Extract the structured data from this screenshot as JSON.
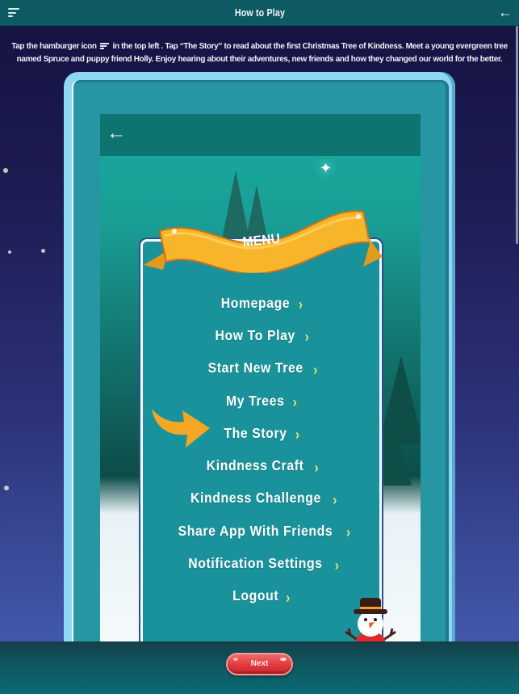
{
  "header": {
    "title": "How to Play",
    "menu_icon": "hamburger-icon",
    "back_icon": "arrow-left-icon"
  },
  "instructions": {
    "part1": "Tap the hamburger icon",
    "part2": "in the top left . Tap “The Story” to read about the first Christmas Tree of Kindness. Meet a young evergreen tree named Spruce and puppy friend Holly. Enjoy hearing about their adventures, new friends and how they changed our world for the better."
  },
  "preview": {
    "back_icon": "arrow-left-icon",
    "ribbon_label": "MENU",
    "highlighted_item": "The Story",
    "menu_items": [
      {
        "label": "Homepage"
      },
      {
        "label": "How To Play"
      },
      {
        "label": "Start New Tree"
      },
      {
        "label": "My Trees"
      },
      {
        "label": "The Story"
      },
      {
        "label": "Kindness Craft"
      },
      {
        "label": "Kindness Challenge"
      },
      {
        "label": "Share App With Friends"
      },
      {
        "label": "Notification Settings"
      },
      {
        "label": "Logout"
      }
    ],
    "chevron": "›"
  },
  "footer": {
    "next_label": "Next"
  },
  "colors": {
    "header_bg": "#0e5a62",
    "panel_teal": "#1a929b",
    "device_frame": "#8ed7f2",
    "ribbon_gold": "#f7b52c",
    "arrow_orange": "#f5a623",
    "chevron_yellow": "#f1e56a",
    "next_button_red": "#e2393e"
  }
}
